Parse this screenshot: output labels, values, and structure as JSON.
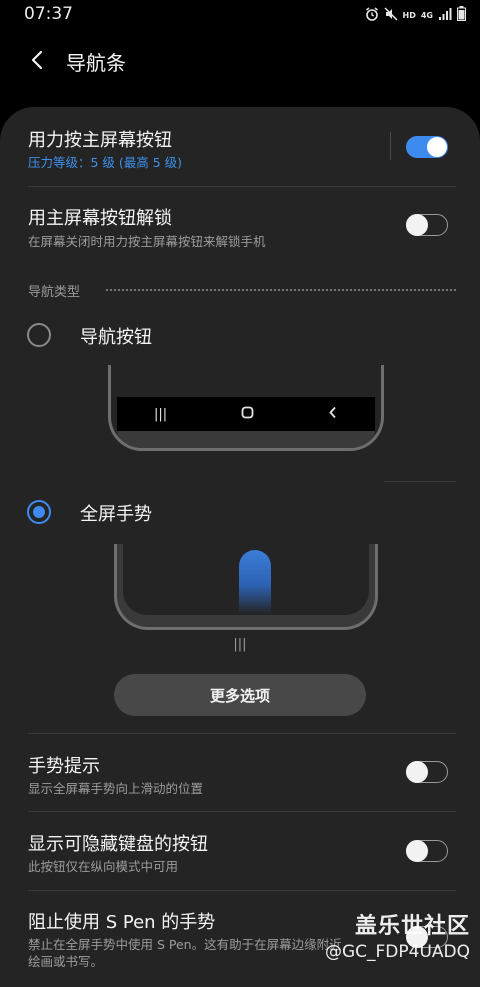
{
  "status_bar": {
    "time": "07:37",
    "hd": "HD",
    "net": "4G"
  },
  "header": {
    "title": "导航条"
  },
  "settings": {
    "pressure": {
      "title": "用力按主屏幕按钮",
      "subtitle": "压力等级：5 级 (最高 5 级)",
      "enabled": true
    },
    "unlock": {
      "title": "用主屏幕按钮解锁",
      "subtitle": "在屏幕关闭时用力按主屏幕按钮来解锁手机",
      "enabled": false
    }
  },
  "nav_type": {
    "section_label": "导航类型",
    "options": [
      {
        "label": "导航按钮",
        "selected": false
      },
      {
        "label": "全屏手势",
        "selected": true
      }
    ],
    "buttons_preview": [
      "|||",
      "O",
      "<"
    ],
    "gesture_hint": "|||",
    "more_options": "更多选项"
  },
  "lower_settings": [
    {
      "title": "手势提示",
      "subtitle": "显示全屏幕手势向上滑动的位置",
      "enabled": false
    },
    {
      "title": "显示可隐藏键盘的按钮",
      "subtitle": "此按钮仅在纵向模式中可用",
      "enabled": false
    },
    {
      "title": "阻止使用 S Pen 的手势",
      "subtitle": "禁止在全屏手势中使用 S Pen。这有助于在屏幕边缘附近",
      "subtitle2": "绘画或书写。",
      "enabled": false
    }
  ],
  "watermark": {
    "line1": "盖乐世社区",
    "line2": "@GC_FDP4UADQ"
  },
  "colors": {
    "accent": "#3e8bef",
    "card": "#242424",
    "background": "#000000"
  }
}
